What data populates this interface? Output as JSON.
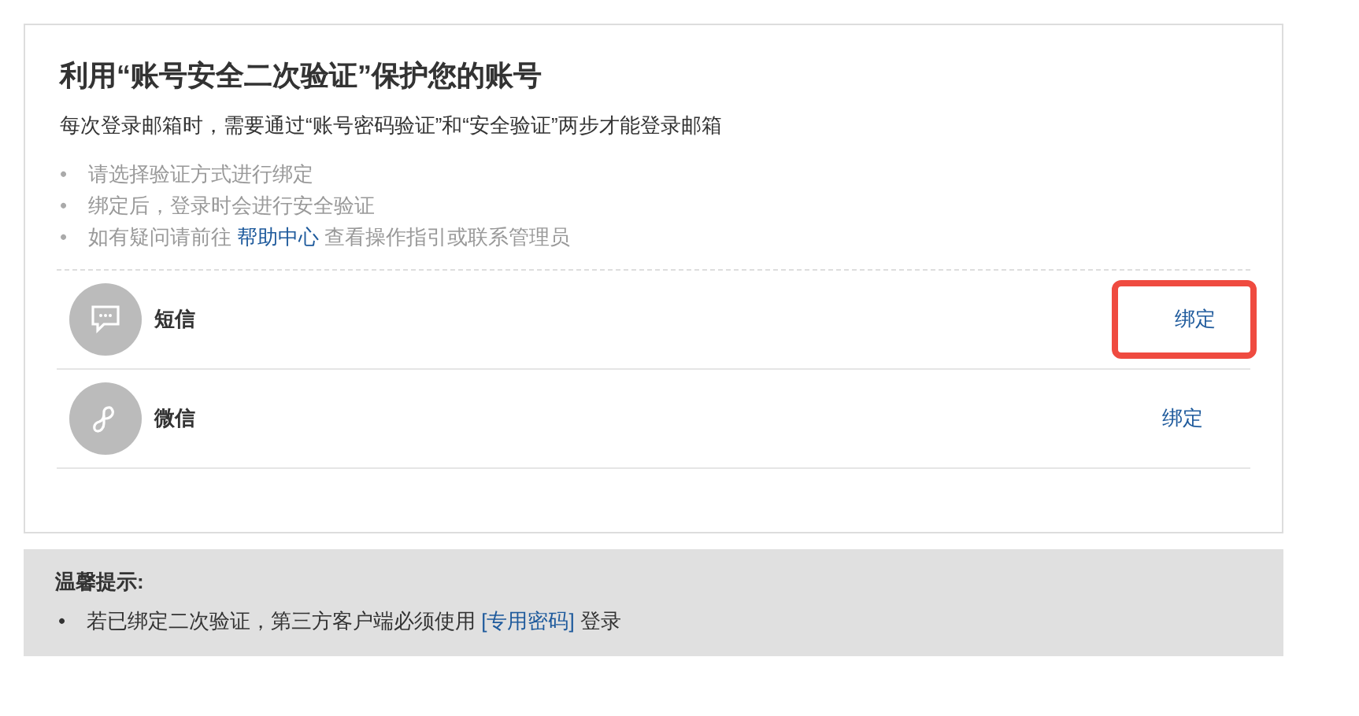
{
  "title": "利用“账号安全二次验证”保护您的账号",
  "subtitle": "每次登录邮箱时，需要通过“账号密码验证”和“安全验证”两步才能登录邮箱",
  "notes": [
    {
      "bullet": "•",
      "text": "请选择验证方式进行绑定"
    },
    {
      "bullet": "•",
      "text": "绑定后，登录时会进行安全验证"
    },
    {
      "bullet": "•",
      "text": "如有疑问请前往",
      "link": "帮助中心",
      "after": "查看操作指引或联系管理员"
    }
  ],
  "methods": [
    {
      "kind": "sms",
      "name": "短信",
      "action": "绑定",
      "highlighted": true
    },
    {
      "kind": "wechat",
      "name": "微信",
      "action": "绑定",
      "highlighted": false
    }
  ],
  "tip": {
    "title": "温馨提示:",
    "items": [
      {
        "bullet": "•",
        "text": "若已绑定二次验证，第三方客户端必须使用",
        "link": "[专用密码]",
        "after": "登录"
      }
    ]
  }
}
